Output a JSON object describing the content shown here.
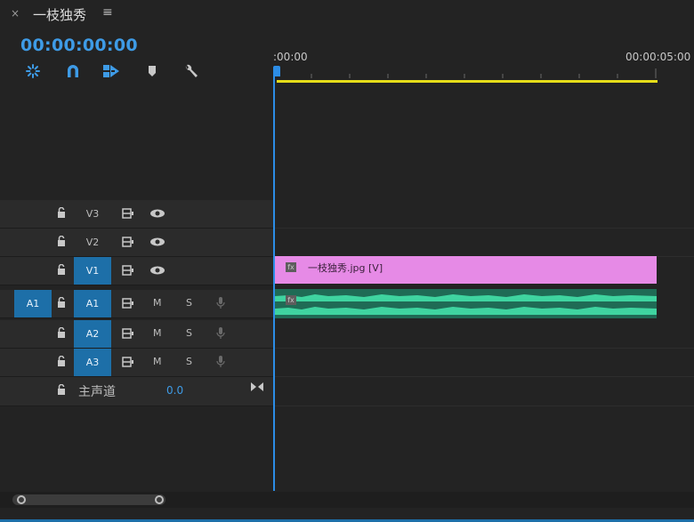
{
  "panel": {
    "close_glyph": "×",
    "sequence_name": "一枝独秀",
    "menu_glyph": "≡"
  },
  "timecode": "00:00:00:00",
  "tools": [
    {
      "name": "snap-nest-icon",
      "interactable": true
    },
    {
      "name": "magnet-icon",
      "interactable": true
    },
    {
      "name": "linked-selection-icon",
      "interactable": true
    },
    {
      "name": "add-marker-icon",
      "interactable": true
    },
    {
      "name": "wrench-icon",
      "interactable": true
    }
  ],
  "ruler": {
    "start_label": ":00:00",
    "end_label": "00:00:05:00"
  },
  "video_tracks": [
    {
      "label": "V3",
      "targeted": false
    },
    {
      "label": "V2",
      "targeted": false
    },
    {
      "label": "V1",
      "targeted": true
    }
  ],
  "audio_tracks": [
    {
      "label": "A1",
      "source": "A1",
      "mute": "M",
      "solo": "S"
    },
    {
      "label": "A2",
      "source": "",
      "mute": "M",
      "solo": "S"
    },
    {
      "label": "A3",
      "source": "",
      "mute": "M",
      "solo": "S"
    }
  ],
  "master": {
    "label": "主声道",
    "value": "0.0"
  },
  "clips": {
    "video_label": "一枝独秀.jpg [V]",
    "fx_badge": "fx"
  },
  "colors": {
    "accent": "#2c8de6",
    "video_clip": "#e68ae6",
    "audio_clip": "#1f6b55",
    "waveform": "#3fd4a0",
    "work_area": "#e6dd1a"
  }
}
